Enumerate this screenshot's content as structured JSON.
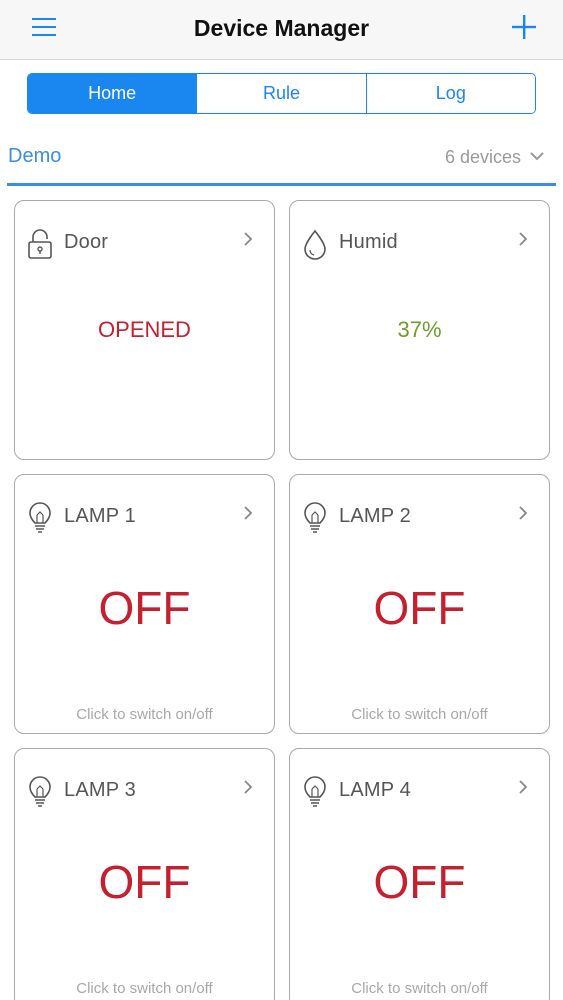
{
  "header": {
    "title": "Device Manager",
    "menu_icon": "hamburger-menu-icon",
    "add_icon": "plus-icon"
  },
  "tabs": [
    {
      "label": "Home",
      "active": true
    },
    {
      "label": "Rule",
      "active": false
    },
    {
      "label": "Log",
      "active": false
    }
  ],
  "group": {
    "name": "Demo",
    "count": "6 devices",
    "toggle_icon": "chevron-down-icon"
  },
  "devices": [
    {
      "name": "Door",
      "icon": "lock-icon",
      "value": "OPENED",
      "value_color": "#c4202f"
    },
    {
      "name": "Humid",
      "icon": "droplet-icon",
      "value": "37%",
      "value_color": "#6e9a2e"
    },
    {
      "name": "LAMP 1",
      "icon": "lightbulb-icon",
      "value": "OFF",
      "hint": "Click to switch on/off",
      "value_color": "#c4202f"
    },
    {
      "name": "LAMP 2",
      "icon": "lightbulb-icon",
      "value": "OFF",
      "hint": "Click to switch on/off",
      "value_color": "#c4202f"
    },
    {
      "name": "LAMP 3",
      "icon": "lightbulb-icon",
      "value": "OFF",
      "hint": "Click to switch on/off",
      "value_color": "#c4202f"
    },
    {
      "name": "LAMP 4",
      "icon": "lightbulb-icon",
      "value": "OFF",
      "hint": "Click to switch on/off",
      "value_color": "#c4202f"
    }
  ],
  "colors": {
    "accent": "#1a86ef",
    "group_blue": "#3b8fe0",
    "off_red": "#c4202f",
    "humid_green": "#6e9a2e"
  }
}
